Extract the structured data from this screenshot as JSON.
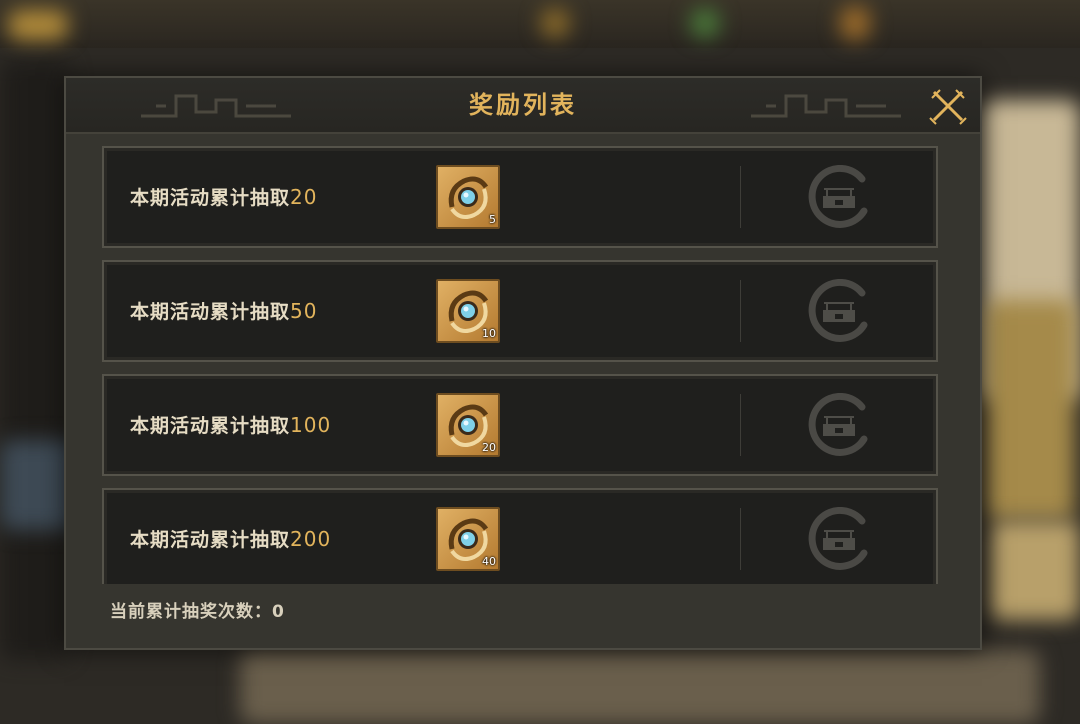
{
  "dialog": {
    "title": "奖励列表",
    "close_icon": "crossed-swords-close-icon",
    "rows": [
      {
        "label": "本期活动累计抽取",
        "count": "20",
        "reward_qty": "5",
        "reward_icon": "blue-gem-ring-icon",
        "status_icon": "lock-icon"
      },
      {
        "label": "本期活动累计抽取",
        "count": "50",
        "reward_qty": "10",
        "reward_icon": "blue-gem-ring-icon",
        "status_icon": "lock-icon"
      },
      {
        "label": "本期活动累计抽取",
        "count": "100",
        "reward_qty": "20",
        "reward_icon": "blue-gem-ring-icon",
        "status_icon": "lock-icon"
      },
      {
        "label": "本期活动累计抽取",
        "count": "200",
        "reward_qty": "40",
        "reward_icon": "blue-gem-ring-icon",
        "status_icon": "lock-icon"
      }
    ],
    "footer": "当前累计抽奖次数：0"
  },
  "colors": {
    "title_gold": "#e2b45c",
    "label_text": "#e6dcc4",
    "row_bg": "#1f1f1d",
    "panel_bg": "#36352f"
  }
}
